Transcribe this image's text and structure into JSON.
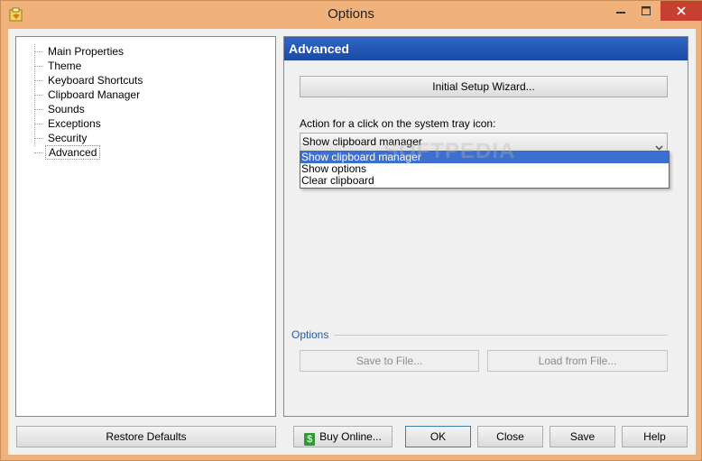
{
  "window": {
    "title": "Options",
    "colors": {
      "frame": "#f0b27a",
      "close": "#c7402f",
      "header": "#2f66c6",
      "selection": "#3d6fd0"
    }
  },
  "tree": {
    "items": [
      {
        "label": "Main Properties"
      },
      {
        "label": "Theme"
      },
      {
        "label": "Keyboard Shortcuts"
      },
      {
        "label": "Clipboard Manager"
      },
      {
        "label": "Sounds"
      },
      {
        "label": "Exceptions"
      },
      {
        "label": "Security"
      },
      {
        "label": "Advanced",
        "selected": true
      }
    ]
  },
  "panel": {
    "title": "Advanced",
    "wizard_label": "Initial Setup Wizard...",
    "action_label": "Action for a click on the system tray icon:",
    "select_value": "Show clipboard manager",
    "dropdown_options": [
      "Show clipboard manager",
      "Show options",
      "Clear clipboard"
    ],
    "options_group_label": "Options",
    "save_to_file_label": "Save to File...",
    "load_from_file_label": "Load from File..."
  },
  "buttons": {
    "restore_defaults": "Restore Defaults",
    "buy_online": "Buy Online...",
    "ok": "OK",
    "close": "Close",
    "save": "Save",
    "help": "Help"
  },
  "watermark": "SOFTPEDIA",
  "icons": [
    "app-icon",
    "minimize-icon",
    "maximize-icon",
    "close-icon",
    "chevron-down-icon",
    "money-icon"
  ]
}
